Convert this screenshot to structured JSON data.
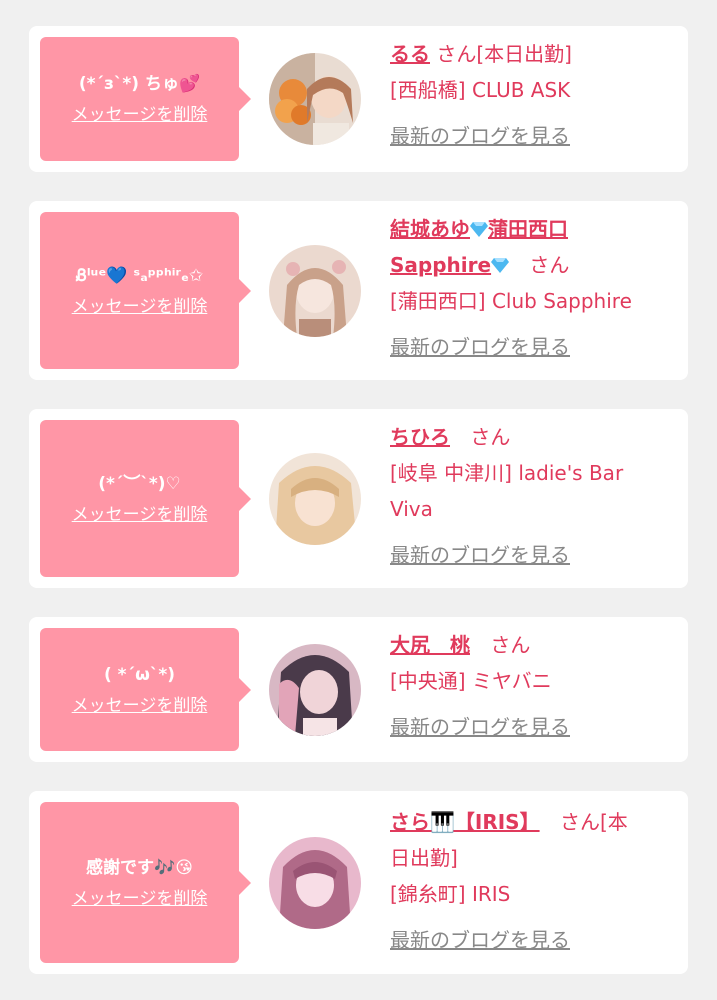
{
  "cards": [
    {
      "message": "(*´з`*) ちゅ💕",
      "delete_label": "メッセージを削除",
      "name": "るる",
      "honorific": "さん[本日出勤]",
      "shop": "[西船橋] CLUB ASK",
      "blog_label": "最新のブログを見る",
      "avatar_colors": [
        "#d8a37a",
        "#f4d8c6",
        "#c77a3a"
      ]
    },
    {
      "message": "Ᏸˡᵘᵉ💙 ˢₐᵖᵖʰⁱʳₑ✩",
      "delete_label": "メッセージを削除",
      "name": "結城あゆ💎蒲田西口Sapphire💎",
      "name_line1": "結城あゆ",
      "name_line1b": "蒲田西口",
      "name_line2": "Sapphire",
      "honorific": "さん",
      "shop": "[蒲田西口] Club Sapphire",
      "blog_label": "最新のブログを見る",
      "avatar_colors": [
        "#e6d0c4",
        "#f6e6de",
        "#b98e7a"
      ]
    },
    {
      "message": "(*´︶`*)♡",
      "delete_label": "メッセージを削除",
      "name": "ちひろ",
      "honorific": "さん",
      "shop_line1": "[岐阜 中津川] ladie's Bar",
      "shop_line2": "Viva",
      "blog_label": "最新のブログを見る",
      "avatar_colors": [
        "#e8c8a0",
        "#f8e2d2",
        "#c79a72"
      ]
    },
    {
      "message": "( *´ω`*)",
      "delete_label": "メッセージを削除",
      "name": "大尻　桃",
      "honorific": "さん",
      "shop": "[中央通] ミヤバニ",
      "blog_label": "最新のブログを見る",
      "avatar_colors": [
        "#4a3a4a",
        "#f0d4d8",
        "#e2a4b8"
      ]
    },
    {
      "message": "感謝です🎶😘",
      "delete_label": "メッセージを削除",
      "name": "さら🎹【IRIS】",
      "honorific_line1": "さん[本",
      "honorific_line2": "日出勤]",
      "shop": "[錦糸町] IRIS",
      "blog_label": "最新のブログを見る",
      "avatar_colors": [
        "#e8a8c0",
        "#f8dde6",
        "#b06a88"
      ]
    }
  ]
}
